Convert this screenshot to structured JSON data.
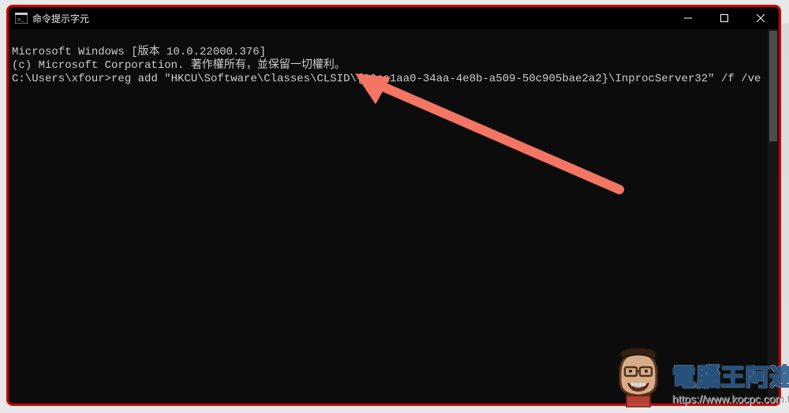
{
  "window": {
    "title": "命令提示字元"
  },
  "terminal": {
    "line1": "Microsoft Windows [版本 10.0.22000.376]",
    "line2": "(c) Microsoft Corporation. 著作權所有，並保留一切權利。",
    "line3": "",
    "prompt": "C:\\Users\\xfour>",
    "command": "reg add \"HKCU\\Software\\Classes\\CLSID\\{86ca1aa0-34aa-4e8b-a509-50c905bae2a2}\\InprocServer32\" /f /ve"
  },
  "watermark": {
    "title": "電腦王阿達",
    "url": "https://www.kocpc.com.tw"
  },
  "icons": {
    "terminal": "terminal-icon",
    "minimize": "minimize-icon",
    "maximize": "maximize-icon",
    "close": "close-icon"
  }
}
